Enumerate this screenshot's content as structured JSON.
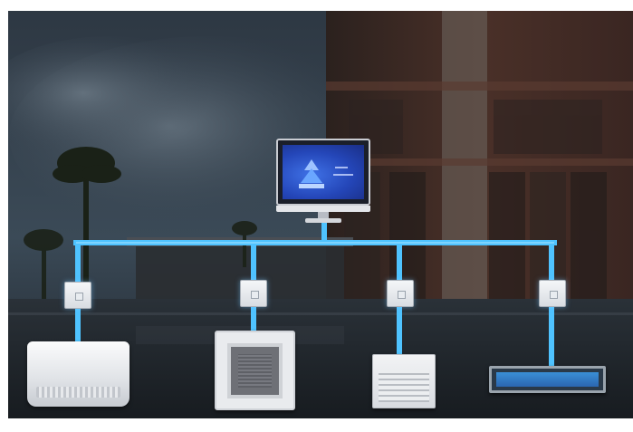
{
  "diagram": {
    "colors": {
      "network_line": "#4fc3ff",
      "sky": "#2b3540",
      "building": "#3a2a24",
      "screen": "#2446b8"
    },
    "nodes": [
      {
        "id": "central-controller",
        "kind": "monitor"
      },
      {
        "id": "module-1",
        "kind": "interface-module"
      },
      {
        "id": "module-2",
        "kind": "interface-module"
      },
      {
        "id": "module-3",
        "kind": "interface-module"
      },
      {
        "id": "module-4",
        "kind": "interface-module"
      },
      {
        "id": "unit-1",
        "kind": "wall-mounted-indoor-unit"
      },
      {
        "id": "unit-2",
        "kind": "cassette-indoor-unit"
      },
      {
        "id": "unit-3",
        "kind": "floor-standing-indoor-unit"
      },
      {
        "id": "unit-4",
        "kind": "ducted-indoor-unit"
      }
    ]
  }
}
